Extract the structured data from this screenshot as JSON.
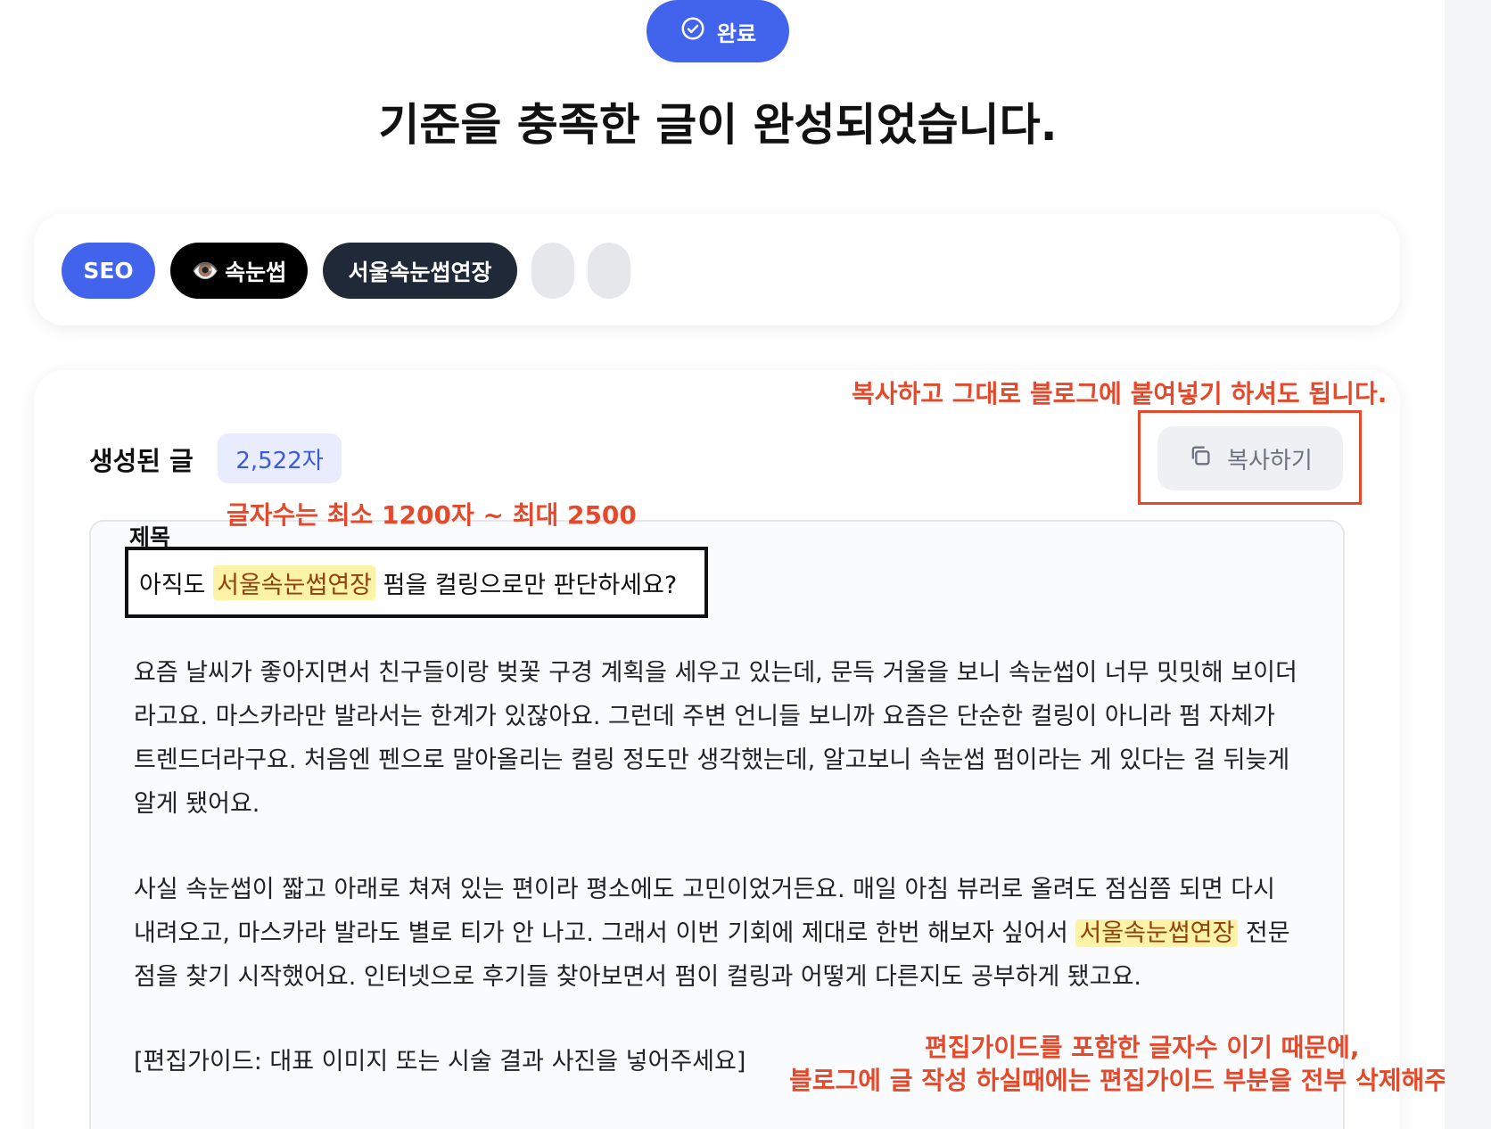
{
  "status": {
    "label": "완료",
    "icon": "check-circle-icon"
  },
  "headline": "기준을 충족한 글이 완성되었습니다.",
  "tags": {
    "seo": "SEO",
    "eye_emoji": "👁️",
    "eyelash": "속눈썹",
    "seoul": "서울속눈썹연장"
  },
  "generated": {
    "label": "생성된 글",
    "count": "2,522자",
    "copy_button": "복사하기",
    "copy_icon": "copy-icon"
  },
  "annotations": {
    "copy_note": "복사하고 그대로 블로그에 붙여넣기 하셔도 됩니다.",
    "count_note": "글자수는 최소 1200자 ~ 최대 2500",
    "guide_note_1": "편집가이드를 포함한 글자수 이기 때문에,",
    "guide_note_2": "블로그에 글 작성 하실때에는 편집가이드 부분을 전부 삭제해주세요."
  },
  "article": {
    "title_label": "제목",
    "title_pre": "아직도",
    "title_keyword": "서울속눈썹연장",
    "title_post": "펌을 컬링으로만 판단하세요?",
    "p1": "요즘 날씨가 좋아지면서 친구들이랑 벚꽃 구경 계획을 세우고 있는데, 문득 거울을 보니 속눈썹이 너무 밋밋해 보이더라고요. 마스카라만 발라서는 한계가 있잖아요. 그런데 주변 언니들 보니까 요즘은 단순한 컬링이 아니라 펌 자체가 트렌드더라구요. 처음엔 펜으로 말아올리는 컬링 정도만 생각했는데, 알고보니 속눈썹 펌이라는 게 있다는 걸 뒤늦게 알게 됐어요.",
    "p2_pre": "사실 속눈썹이 짧고 아래로 쳐져 있는 편이라 평소에도 고민이었거든요. 매일 아침 뷰러로 올려도 점심쯤 되면 다시 내려오고, 마스카라 발라도 별로 티가 안 나고. 그래서 이번 기회에 제대로 한번 해보자 싶어서",
    "p2_keyword": "서울속눈썹연장",
    "p2_post": "전문점을 찾기 시작했어요. 인터넷으로 후기들 찾아보면서 펌이 컬링과 어떻게 다른지도 공부하게 됐고요.",
    "p3": "[편집가이드: 대표 이미지 또는 시술 결과 사진을 넣어주세요]"
  },
  "colors": {
    "accent": "#4263eb",
    "annotation": "#e5492b",
    "highlight": "#fdf3a6"
  }
}
